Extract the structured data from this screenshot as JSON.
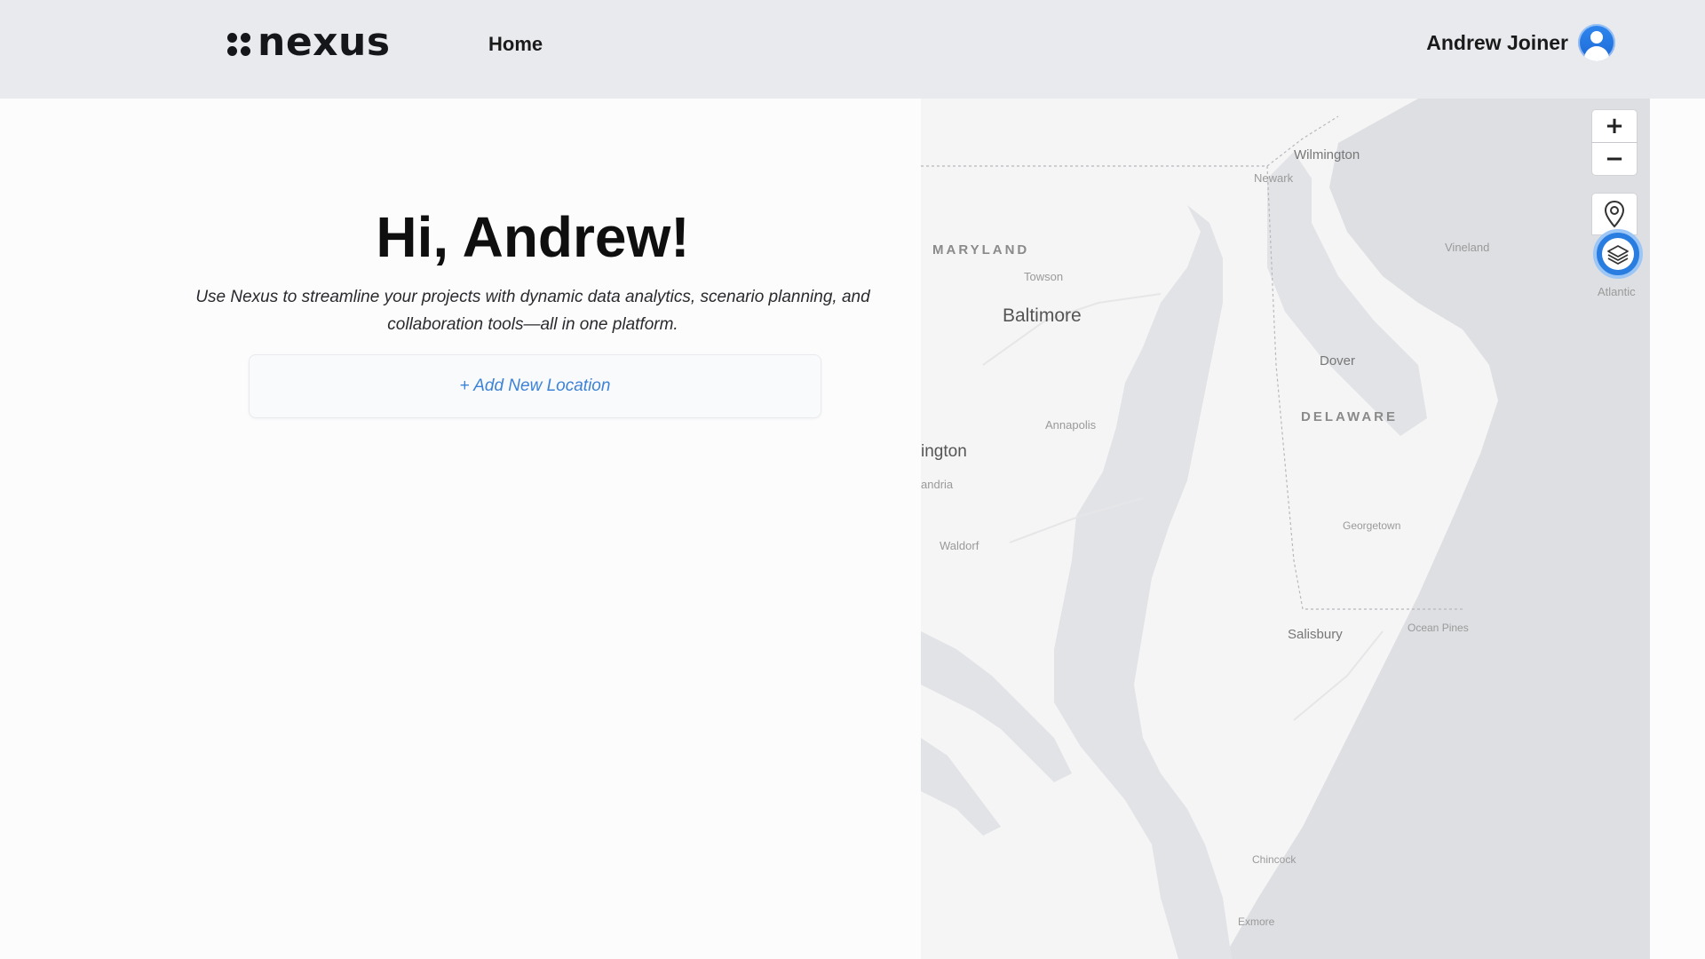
{
  "header": {
    "logo_text": "nexus",
    "nav_home": "Home",
    "user_name": "Andrew Joiner"
  },
  "main": {
    "greeting": "Hi, Andrew!",
    "subtitle": "Use Nexus to streamline your projects with dynamic data analytics, scenario planning, and collaboration tools—all in one platform.",
    "add_location_label": "+ Add New Location"
  },
  "map": {
    "zoom_in": "+",
    "zoom_out": "−",
    "labels": {
      "wilmington": "Wilmington",
      "newark": "Newark",
      "vineland": "Vineland",
      "maryland": "MARYLAND",
      "towson": "Towson",
      "baltimore": "Baltimore",
      "atlantic": "Atlantic",
      "dover": "Dover",
      "delaware": "DELAWARE",
      "annapolis": "Annapolis",
      "washington": "ington",
      "alexandria": "andria",
      "waldorf": "Waldorf",
      "georgetown": "Georgetown",
      "salisbury": "Salisbury",
      "ocean_pines": "Ocean Pines",
      "chincoteague": "Chincock",
      "exmore": "Exmore"
    }
  },
  "colors": {
    "accent": "#3c82d6",
    "header_bg": "#e9eaee",
    "layers_button": "#2a7de0"
  }
}
